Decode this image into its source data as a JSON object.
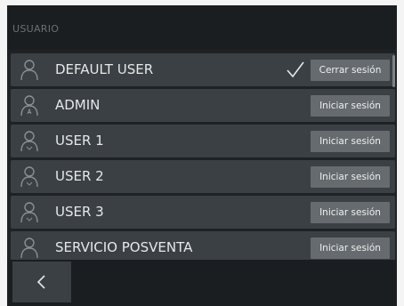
{
  "header": {
    "title": "USUARIO"
  },
  "users": [
    {
      "name": "DEFAULT USER",
      "action": "Cerrar sesión",
      "active": true
    },
    {
      "name": "ADMIN",
      "action": "Iniciar sesión",
      "active": false
    },
    {
      "name": "USER 1",
      "action": "Iniciar sesión",
      "active": false
    },
    {
      "name": "USER 2",
      "action": "Iniciar sesión",
      "active": false
    },
    {
      "name": "USER 3",
      "action": "Iniciar sesión",
      "active": false
    },
    {
      "name": "SERVICIO POSVENTA",
      "action": "Iniciar sesión",
      "active": false
    }
  ],
  "icons": {
    "user": "user-icon",
    "check": "checkmark-icon",
    "back": "chevron-left-icon"
  },
  "colors": {
    "background": "#1f2224",
    "row": "#3a4043",
    "button": "#656b6e",
    "text": "#e6e8e9"
  }
}
